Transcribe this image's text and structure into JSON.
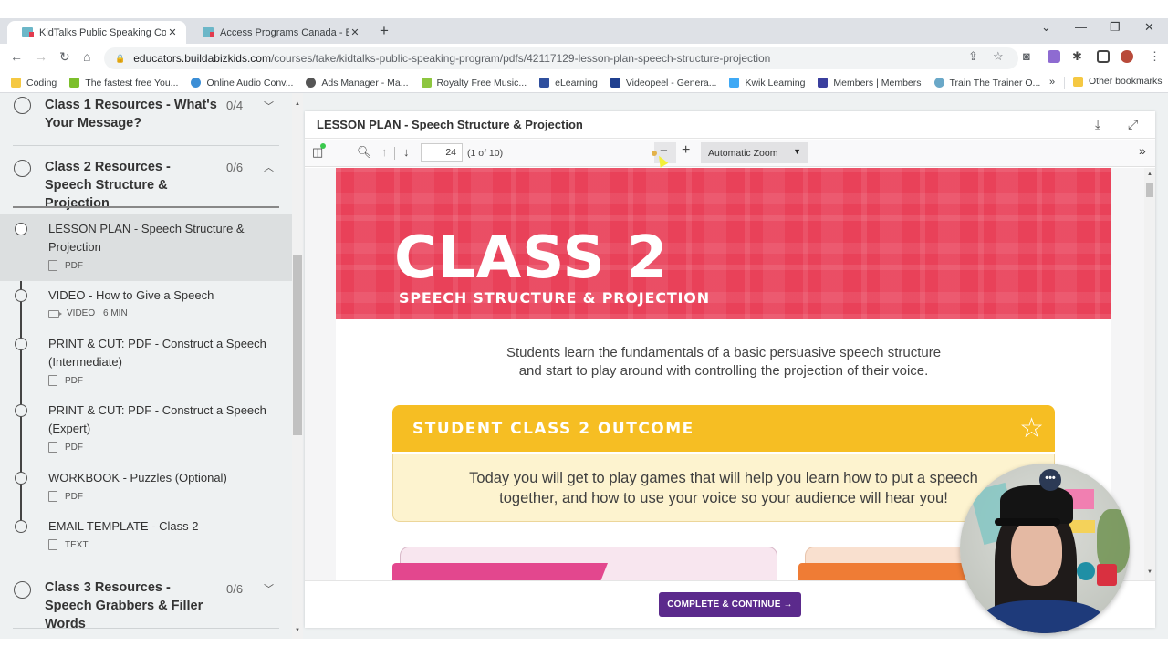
{
  "browser": {
    "tabs": [
      {
        "title": "KidTalks Public Speaking Course",
        "active": true
      },
      {
        "title": "Access Programs Canada - Build",
        "active": false
      }
    ],
    "new_tab_label": "+",
    "window_controls": {
      "tab_search": "⌄",
      "minimize": "—",
      "restore": "❐",
      "close": "✕"
    },
    "url": {
      "host": "educators.buildabizkids.com",
      "path": "/courses/take/kidtalks-public-speaking-program/pdfs/42117129-lesson-plan-speech-structure-projection"
    },
    "nav": {
      "back": "←",
      "forward": "→",
      "reload": "↻",
      "home": "⌂"
    },
    "bookmarks": [
      {
        "label": "Coding",
        "icon": "folder-icon",
        "color": "#f5c842"
      },
      {
        "label": "The fastest free You...",
        "icon": "download-arrow-icon",
        "color": "#7cbf2b"
      },
      {
        "label": "Online Audio Conv...",
        "icon": "dots-icon",
        "color": "#3b8ed6"
      },
      {
        "label": "Ads Manager - Ma...",
        "icon": "globe-icon",
        "color": "#555555"
      },
      {
        "label": "Royalty Free Music...",
        "icon": "b-logo-icon",
        "color": "#8dc63f"
      },
      {
        "label": "eLearning",
        "icon": "elearning-icon",
        "color": "#2f4f9e"
      },
      {
        "label": "Videopeel - Genera...",
        "icon": "videopeel-icon",
        "color": "#1f3f8f"
      },
      {
        "label": "Kwik Learning",
        "icon": "kwik-icon",
        "color": "#3fa9f5"
      },
      {
        "label": "Members | Members",
        "icon": "members-icon",
        "color": "#3a3f9e"
      },
      {
        "label": "Train The Trainer O...",
        "icon": "globe-icon",
        "color": "#6aa8c8"
      }
    ],
    "bookmarks_more": "»",
    "other_bookmarks": "Other bookmarks"
  },
  "sidebar": {
    "sections": [
      {
        "title": "Class 1 Resources - What's Your Message?",
        "count": "0/4",
        "expanded": false
      },
      {
        "title": "Class 2 Resources - Speech Structure & Projection",
        "count": "0/6",
        "expanded": true
      },
      {
        "title": "Class 3 Resources - Speech Grabbers & Filler Words",
        "count": "0/6",
        "expanded": false
      }
    ],
    "lessons": [
      {
        "title": "LESSON PLAN - Speech Structure & Projection",
        "type": "PDF",
        "active": true
      },
      {
        "title": "VIDEO - How to Give a Speech",
        "type": "VIDEO · 6 MIN",
        "active": false
      },
      {
        "title": "PRINT & CUT: PDF - Construct a Speech (Intermediate)",
        "type": "PDF",
        "active": false
      },
      {
        "title": "PRINT & CUT: PDF - Construct a Speech (Expert)",
        "type": "PDF",
        "active": false
      },
      {
        "title": "WORKBOOK - Puzzles (Optional)",
        "type": "PDF",
        "active": false
      },
      {
        "title": "EMAIL TEMPLATE - Class 2",
        "type": "TEXT",
        "active": false
      }
    ]
  },
  "viewer": {
    "title": "LESSON PLAN - Speech Structure & Projection",
    "toolbar": {
      "page_number": "24",
      "page_count": "(1 of 10)",
      "zoom_option": "Automatic Zoom"
    },
    "document": {
      "banner_title": "CLASS 2",
      "banner_subtitle": "SPEECH STRUCTURE & PROJECTION",
      "intro_line1": "Students learn the fundamentals of a basic persuasive speech structure",
      "intro_line2": "and start to play around with controlling the projection of their voice.",
      "outcome_heading": "STUDENT CLASS 2 OUTCOME",
      "outcome_line1": "Today you will get to play games that will help you learn how to put a speech",
      "outcome_line2": "together, and how to use your voice so your audience will hear you!"
    },
    "complete_button": "COMPLETE & CONTINUE  →"
  },
  "colors": {
    "banner_red": "#e94159",
    "outcome_yellow": "#f6be23",
    "complete_purple": "#5b2a8c",
    "card_pink": "#e3478e",
    "card_orange": "#ef7c35"
  }
}
